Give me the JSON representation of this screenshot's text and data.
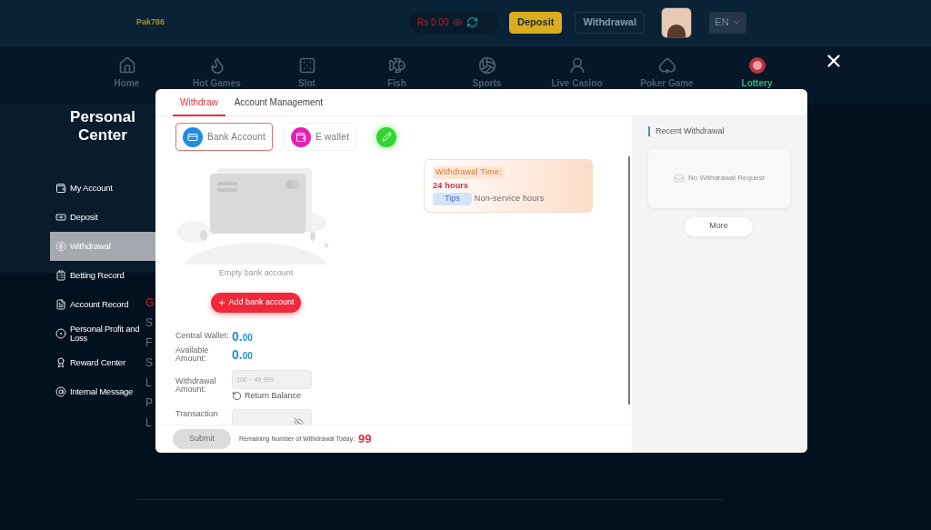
{
  "header": {
    "logo": "Pak786",
    "balance": "Rs 0.00",
    "buttons": [
      {
        "label": "Deposit",
        "kind": "primary"
      },
      {
        "label": "Withdrawal",
        "kind": "outline"
      }
    ],
    "language": "EN"
  },
  "nav": [
    {
      "label": "Home",
      "selected": false
    },
    {
      "label": "Hot Games",
      "selected": false
    },
    {
      "label": "Slot",
      "selected": false
    },
    {
      "label": "Fish",
      "selected": false
    },
    {
      "label": "Sports",
      "selected": false
    },
    {
      "label": "Live Casino",
      "selected": false
    },
    {
      "label": "Poker Game",
      "selected": false
    },
    {
      "label": "Lottery",
      "selected": true
    }
  ],
  "sidebar": {
    "title": "Personal Center",
    "items": [
      {
        "label": "My Account",
        "selected": false
      },
      {
        "label": "Deposit",
        "selected": false
      },
      {
        "label": "Withdrawal",
        "selected": true
      },
      {
        "label": "Betting Record",
        "selected": false
      },
      {
        "label": "Account Record",
        "selected": false
      },
      {
        "label": "Personal Profit and Loss",
        "selected": false
      },
      {
        "label": "Reward Center",
        "selected": false
      },
      {
        "label": "Internal Message",
        "selected": false
      }
    ]
  },
  "background_menu": [
    {
      "text": "G",
      "selected": true
    },
    {
      "text": "S",
      "selected": false
    },
    {
      "text": "F",
      "selected": false
    },
    {
      "text": "S",
      "selected": false
    },
    {
      "text": "L",
      "selected": false
    },
    {
      "text": "P",
      "selected": false
    },
    {
      "text": "L",
      "selected": false
    }
  ],
  "modal": {
    "tabs": [
      {
        "label": "Withdraw",
        "selected": true
      },
      {
        "label": "Account Management",
        "selected": false
      }
    ],
    "methods": [
      {
        "label": "Bank Account",
        "kind": "bank",
        "selected": true
      },
      {
        "label": "E wallet",
        "kind": "ewallet",
        "selected": false
      }
    ],
    "empty_text": "Empty bank account",
    "add_button": "Add bank account",
    "withdrawal_time": {
      "label": "Withdrawal Time:",
      "value": "24 hours",
      "tips_label": "Tips",
      "tips_text": "Non-service hours"
    },
    "balances": [
      {
        "label": "Central Wallet:",
        "main": "0.",
        "decimals": "00"
      },
      {
        "label": "Available Amount:",
        "main": "0.",
        "decimals": "00"
      }
    ],
    "amount": {
      "label": "Withdrawal Amount:",
      "placeholder": "100 ~ 49,999",
      "return_balance": "Return Balance"
    },
    "transaction": {
      "label": "Transaction"
    },
    "submit": {
      "label": "Submit",
      "disabled": true
    },
    "remaining": {
      "label": "Remaining Number of Withdrawal Today:",
      "value": "99"
    },
    "recent": {
      "title": "Recent Withdrawal",
      "empty": "No Withdrawal Request",
      "more": "More"
    }
  }
}
